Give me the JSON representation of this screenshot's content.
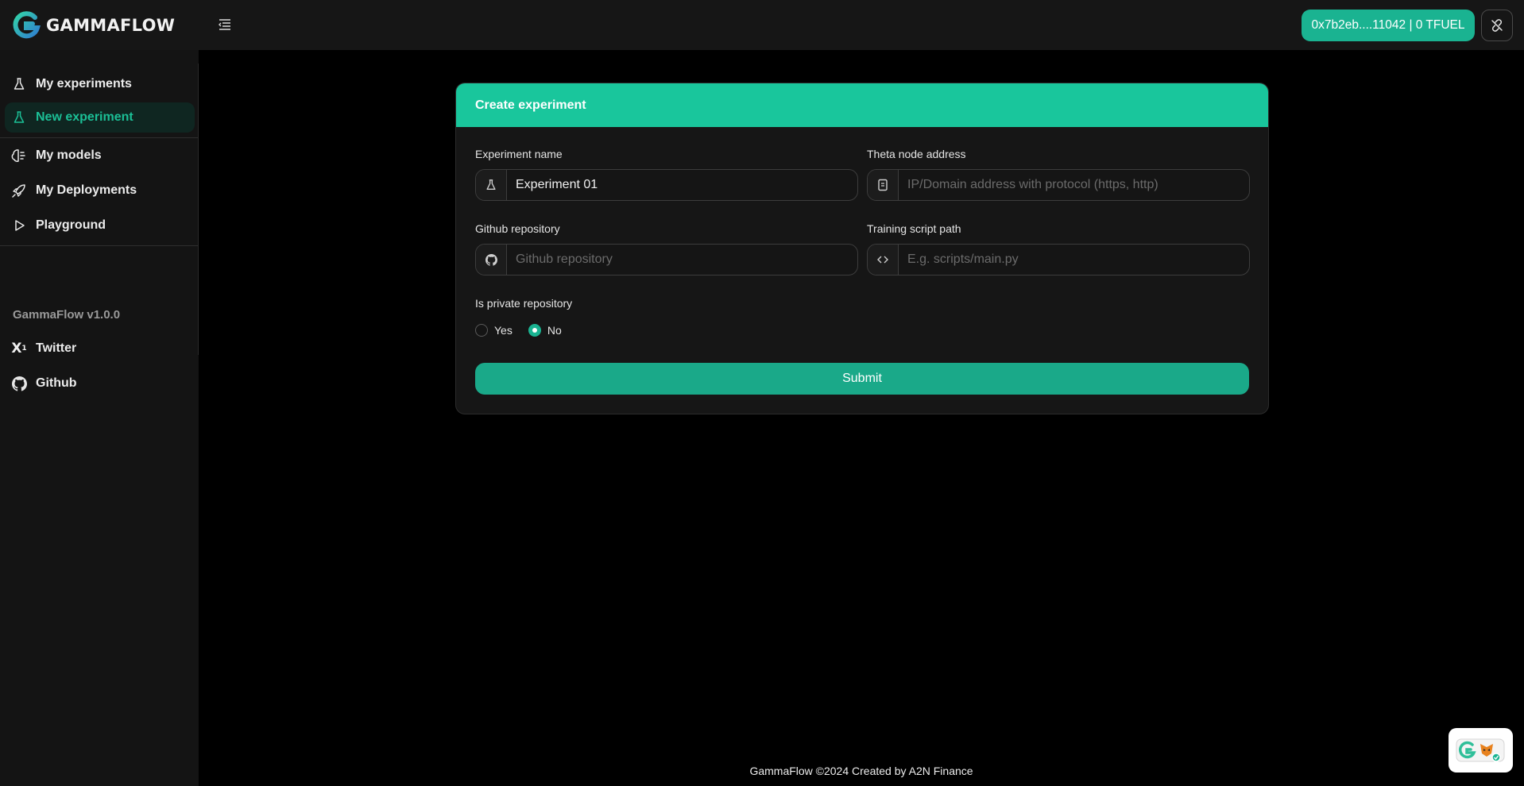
{
  "app": {
    "brand": "GAMMAFLOW"
  },
  "header": {
    "wallet_label": "0x7b2eb....11042 | 0 TFUEL"
  },
  "sidebar": {
    "items": [
      {
        "label": "My experiments",
        "icon": "flask-icon"
      },
      {
        "label": "New experiment",
        "icon": "flask-icon",
        "active": true
      },
      {
        "label": "My models",
        "icon": "brain-icon"
      },
      {
        "label": "My Deployments",
        "icon": "rocket-icon"
      },
      {
        "label": "Playground",
        "icon": "play-icon"
      }
    ],
    "version": "GammaFlow v1.0.0",
    "links": [
      {
        "label": "Twitter",
        "icon": "x-logo-icon"
      },
      {
        "label": "Github",
        "icon": "github-icon"
      }
    ]
  },
  "form": {
    "title": "Create experiment",
    "experiment_name": {
      "label": "Experiment name",
      "value": "Experiment 01",
      "placeholder": ""
    },
    "theta_node": {
      "label": "Theta node address",
      "value": "",
      "placeholder": "IP/Domain address with protocol (https, http)"
    },
    "github_repo": {
      "label": "Github repository",
      "value": "",
      "placeholder": "Github repository"
    },
    "script_path": {
      "label": "Training script path",
      "value": "",
      "placeholder": "E.g. scripts/main.py"
    },
    "private_repo": {
      "label": "Is private repository",
      "options": [
        "Yes",
        "No"
      ],
      "selected": "No"
    },
    "submit_label": "Submit"
  },
  "footer": {
    "text": "GammaFlow ©2024 Created by A2N Finance"
  },
  "colors": {
    "accent": "#1ab391",
    "header_teal": "#19c69c",
    "background": "#000000",
    "panel": "#161616"
  }
}
